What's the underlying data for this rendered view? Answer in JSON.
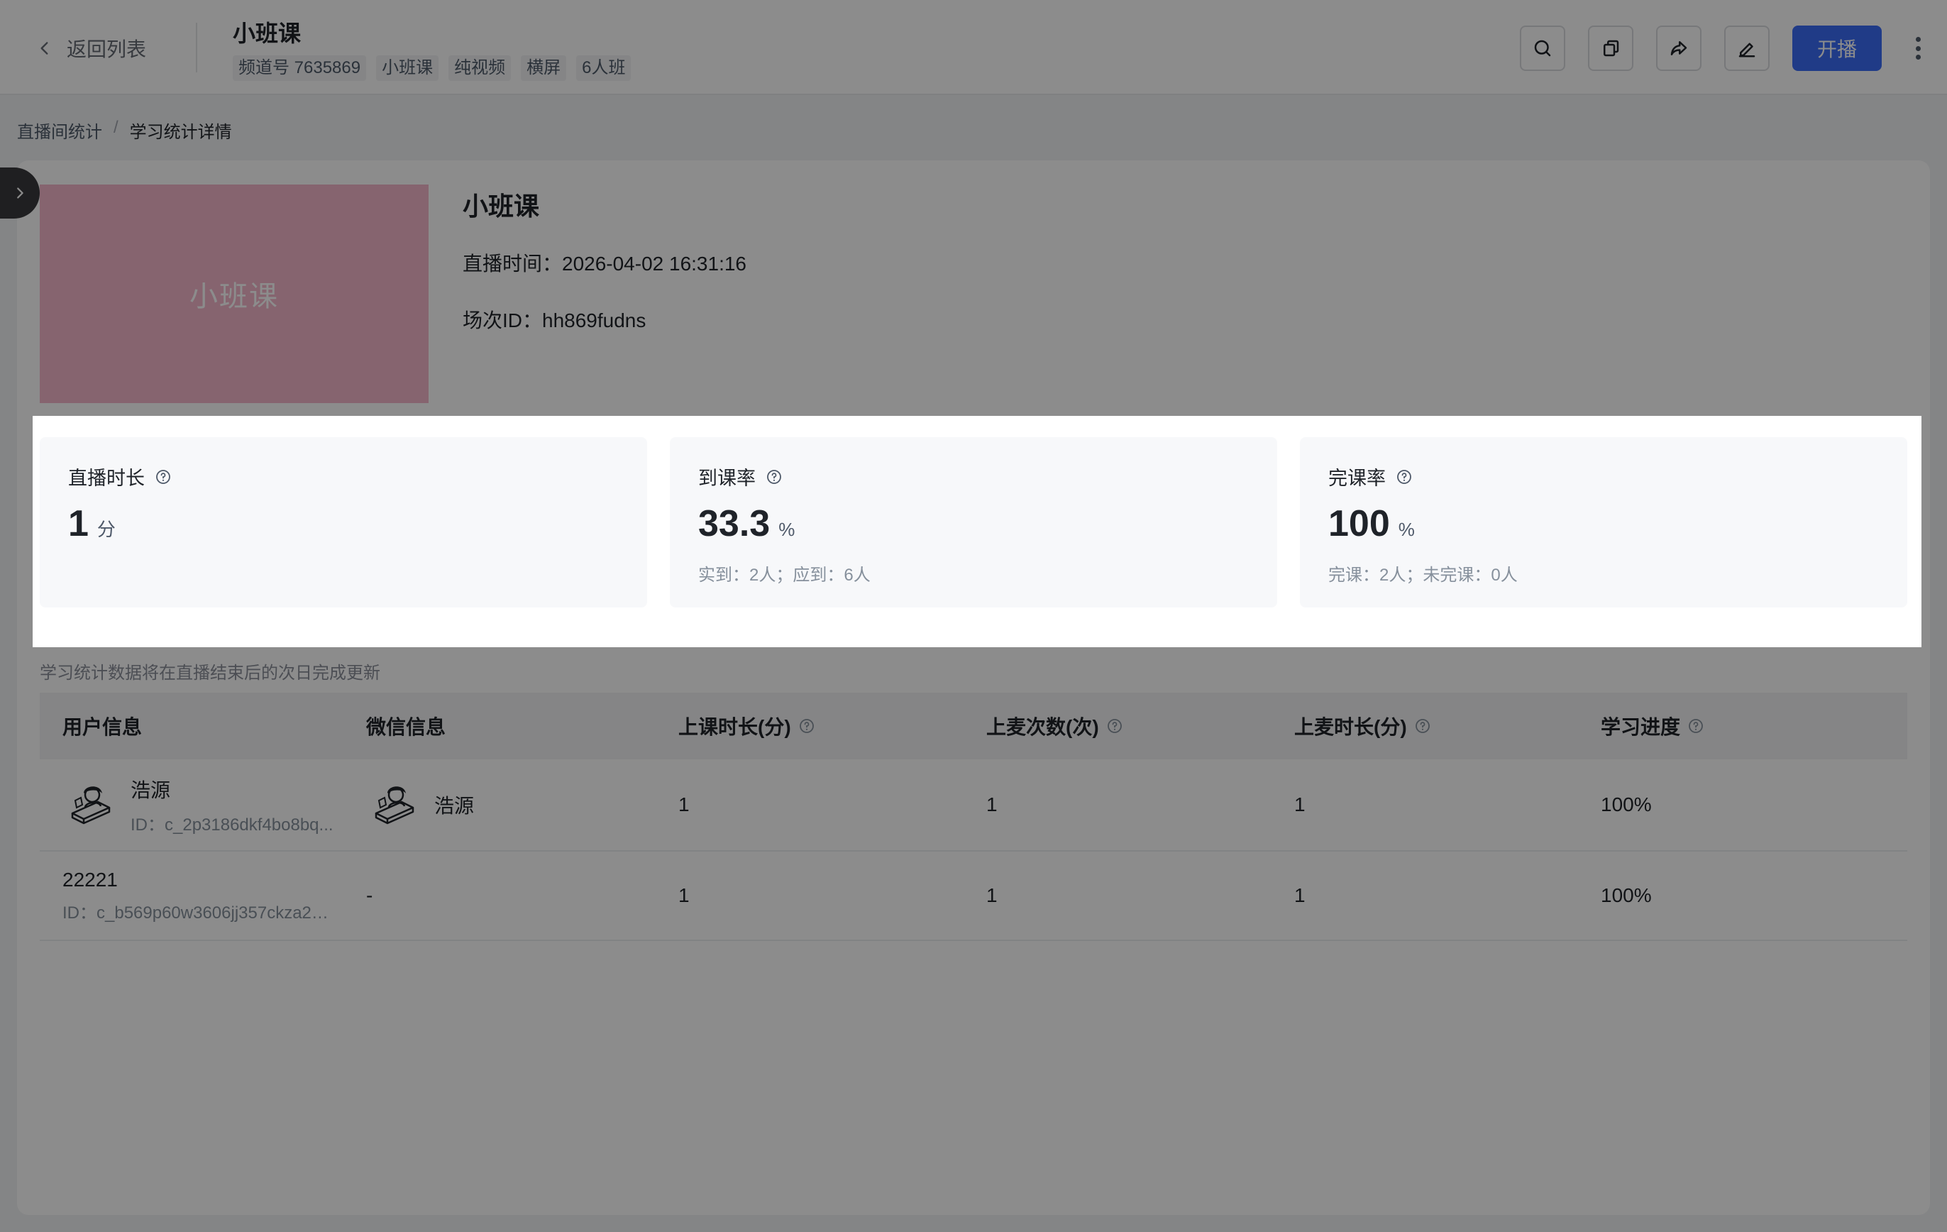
{
  "header": {
    "back_label": "返回列表",
    "title": "小班课",
    "tags": [
      "频道号 7635869",
      "小班课",
      "纯视频",
      "横屏",
      "6人班"
    ],
    "live_button": "开播",
    "tools": [
      "search-icon",
      "copy-icon",
      "share-icon",
      "edit-icon"
    ]
  },
  "breadcrumb": {
    "parent": "直播间统计",
    "separator": "/",
    "current": "学习统计详情"
  },
  "course": {
    "cover_text": "小班课",
    "title": "小班课",
    "live_time": "直播时间：2026-04-02 16:31:16",
    "session_id": "场次ID：hh869fudns"
  },
  "stats": [
    {
      "label": "直播时长",
      "value": "1",
      "unit": "分",
      "sub": ""
    },
    {
      "label": "到课率",
      "value": "33.3",
      "unit": "%",
      "sub": "实到：2人；应到：6人"
    },
    {
      "label": "完课率",
      "value": "100",
      "unit": "%",
      "sub": "完课：2人；未完课：0人"
    }
  ],
  "note": "学习统计数据将在直播结束后的次日完成更新",
  "table": {
    "headers": [
      "用户信息",
      "微信信息",
      "上课时长(分)",
      "上麦次数(次)",
      "上麦时长(分)",
      "学习进度"
    ],
    "rows": [
      {
        "name": "浩源",
        "id": "ID：c_2p3186dkf4bo8bq...",
        "wechat": "浩源",
        "duration": "1",
        "mic_count": "1",
        "mic_duration": "1",
        "progress": "100%"
      },
      {
        "name": "22221",
        "id": "ID：c_b569p60w3606jj357ckza23...",
        "wechat": "-",
        "duration": "1",
        "mic_count": "1",
        "mic_duration": "1",
        "progress": "100%"
      }
    ]
  },
  "colors": {
    "accent": "#3b6cf6",
    "cover": "#f4b6cb"
  }
}
